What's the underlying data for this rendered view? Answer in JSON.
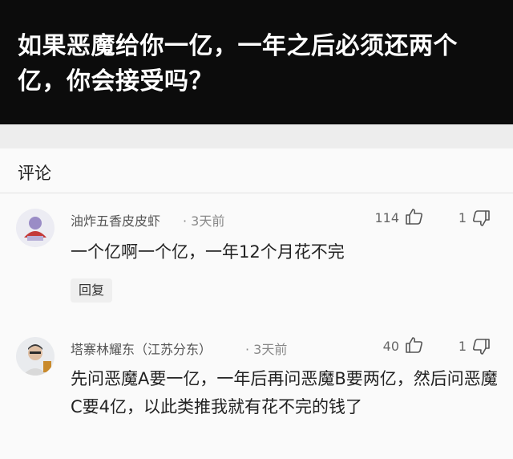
{
  "question": {
    "title": "如果恶魔给你一亿，一年之后必须还两个亿，你会接受吗？"
  },
  "comments_section": {
    "header": "评论",
    "comments": [
      {
        "username": "油炸五香皮皮虾",
        "time": "· 3天前",
        "likes": "114",
        "dislikes": "1",
        "text": "一个亿啊一个亿，一年12个月花不完",
        "reply_label": "回复"
      },
      {
        "username": "塔寨林耀东（江苏分东）",
        "time": "· 3天前",
        "likes": "40",
        "dislikes": "1",
        "text": "先问恶魔A要一亿，一年后再问恶魔B要两亿，然后问恶魔C要4亿，以此类推我就有花不完的钱了"
      }
    ]
  },
  "icons": [
    "thumbs-up-icon",
    "thumbs-down-icon"
  ]
}
